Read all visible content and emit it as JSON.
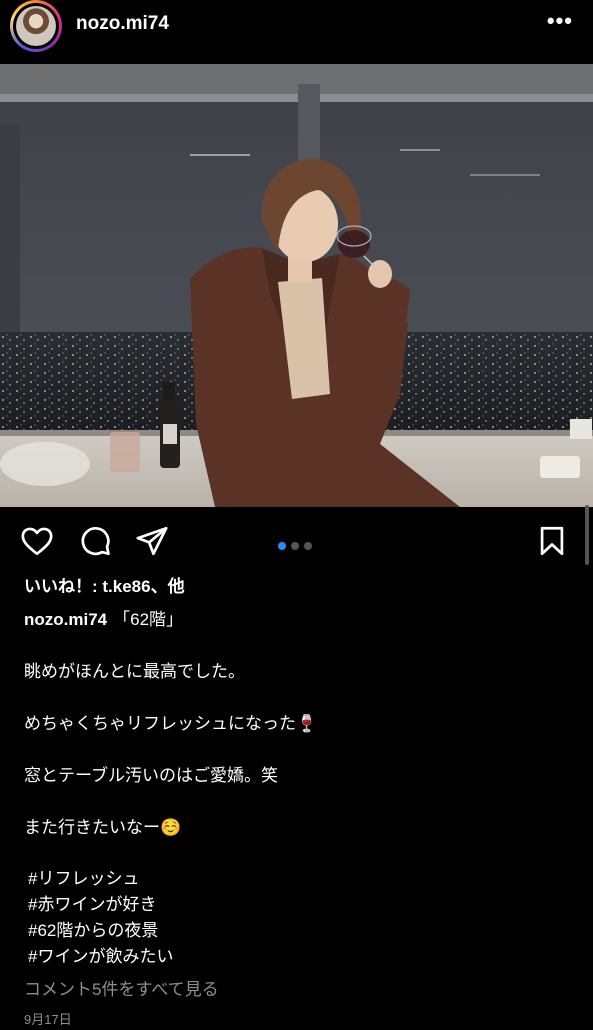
{
  "header": {
    "username": "nozo.mi74",
    "more_icon": "more-horizontal-icon",
    "more_label": "•••"
  },
  "post": {
    "image_alt": "photo",
    "carousel": {
      "count": 3,
      "active": 1
    }
  },
  "actions": {
    "like_icon": "heart-icon",
    "comment_icon": "comment-icon",
    "share_icon": "send-icon",
    "save_icon": "bookmark-icon"
  },
  "likes": {
    "text": "いいね！: t.ke86、他"
  },
  "caption": {
    "username": "nozo.mi74",
    "title": "「62階」",
    "lines": [
      "眺めがほんとに最高でした。",
      "めちゃくちゃリフレッシュになった🍷",
      "窓とテーブル汚いのはご愛嬌。笑",
      "また行きたいなー☺️"
    ],
    "hashtags": [
      "#リフレッシュ",
      "#赤ワインが好き",
      "#62階からの夜景",
      "#ワインが飲みたい"
    ]
  },
  "comments": {
    "view_all": "コメント5件をすべて見る"
  },
  "date": {
    "text": "9月17日"
  },
  "colors": {
    "accent": "#2b8af6",
    "muted": "#8e8e8e",
    "background": "#000000"
  }
}
